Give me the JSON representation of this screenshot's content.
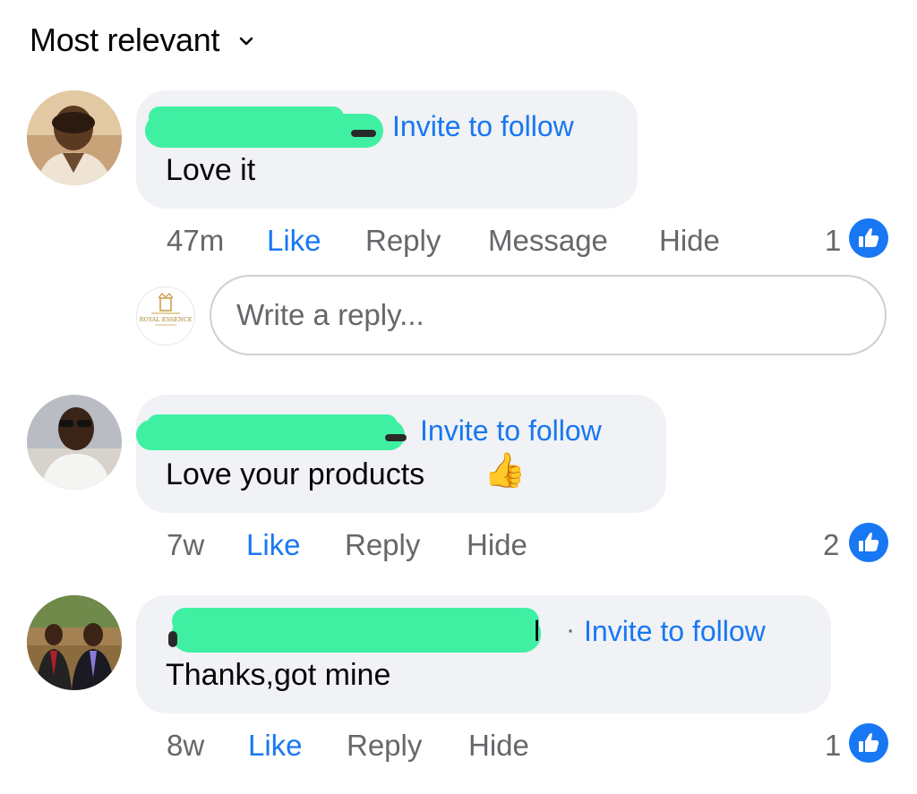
{
  "header": {
    "sort_label": "Most relevant",
    "chevron_icon": "chevron-down-icon"
  },
  "colors": {
    "link": "#1877f2",
    "meta": "#65676b",
    "bubble": "#f0f2f5",
    "redaction": "#3ff0a3"
  },
  "comments": [
    {
      "invite": "Invite to follow",
      "text": "Love it",
      "time": "47m",
      "actions": {
        "like": "Like",
        "reply": "Reply",
        "message": "Message",
        "hide": "Hide"
      },
      "likes": "1"
    },
    {
      "invite": "Invite to follow",
      "text": "Love your products",
      "emoji": "👍",
      "time": "7w",
      "actions": {
        "like": "Like",
        "reply": "Reply",
        "hide": "Hide"
      },
      "likes": "2"
    },
    {
      "name_fragment": "l",
      "separator": "·",
      "invite": "Invite to follow",
      "text": "Thanks,got mine",
      "time": "8w",
      "actions": {
        "like": "Like",
        "reply": "Reply",
        "hide": "Hide"
      },
      "likes": "1"
    }
  ],
  "reply_box": {
    "placeholder": "Write a reply...",
    "value": "",
    "page_logo_text": "ROYAL ESSENCE"
  }
}
